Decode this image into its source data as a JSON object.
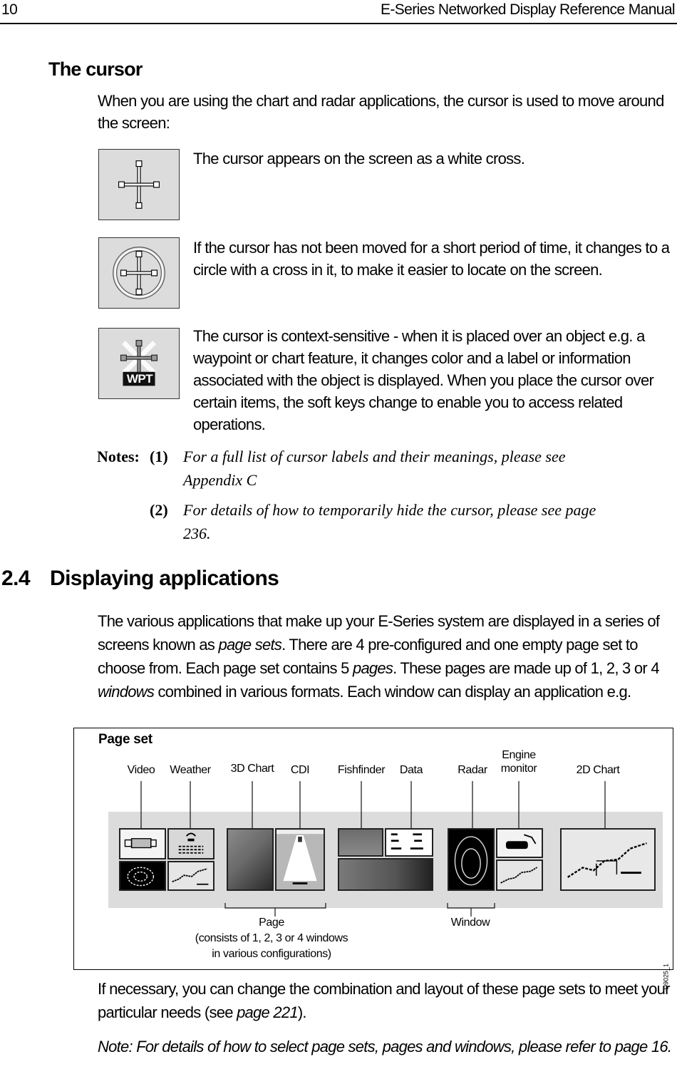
{
  "header": {
    "page_number": "10",
    "running_title": "E-Series Networked Display Reference Manual"
  },
  "cursor_section": {
    "heading": "The cursor",
    "intro": "When you are using the chart and radar applications, the cursor is used to move around the screen:",
    "items": [
      {
        "icon": "white-cross-cursor-icon",
        "text": "The cursor appears on the screen as a white cross."
      },
      {
        "icon": "circle-cross-cursor-icon",
        "text": "If the cursor has not been moved for a short period of time, it changes to a circle with a cross in it, to make it easier to locate on the screen."
      },
      {
        "icon": "context-cursor-wpt-icon",
        "badge": "WPT",
        "text": "The cursor is context-sensitive - when it is placed over an object e.g. a waypoint or chart feature, it changes color and a label or information associated with the object is displayed. When you place the cursor over certain items, the soft keys change to enable you to access related operations."
      }
    ],
    "notes": {
      "label": "Notes:",
      "items": [
        {
          "num": "(1)",
          "text": "For a full list of cursor labels and their meanings, please see Appendix C"
        },
        {
          "num": "(2)",
          "text": "For details of how to temporarily hide the cursor, please see page 236."
        }
      ]
    }
  },
  "applications_section": {
    "number": "2.4",
    "heading": "Displaying applications",
    "para1": {
      "t1": "The various applications that make up your E-Series system are displayed in a series of screens known as ",
      "em1": "page sets",
      "t2": ". There are 4 pre-configured and one empty page set to choose from. Each page set contains 5 ",
      "em2": "pages",
      "t3": ". These pages are made up of 1, 2, 3 or 4 ",
      "em3": "windows",
      "t4": " combined in various formats. Each window can display an application e.g."
    },
    "diagram": {
      "title": "Page set",
      "app_labels": [
        "Video",
        "Weather",
        "3D Chart",
        "CDI",
        "Fishfinder",
        "Data",
        "Radar",
        "Engine\nmonitor",
        "2D Chart"
      ],
      "page_label": "Page",
      "page_caption_1": "(consists of 1, 2, 3 or 4 windows",
      "page_caption_2": "in various configurations)",
      "window_label": "Window",
      "figure_id": "D9025_1"
    },
    "para2": {
      "t1": "If necessary, you can change the combination and layout of these page sets to meet your particular needs (see ",
      "em1": "page 221",
      "t2": ")."
    },
    "note": {
      "t1": "Note: For details of how to select page sets, pages and windows, please refer to ",
      "em1": "page 16",
      "t2": "."
    }
  }
}
